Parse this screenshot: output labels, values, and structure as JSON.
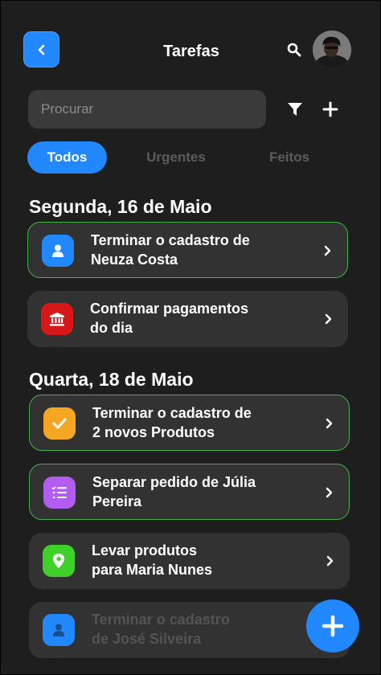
{
  "header": {
    "title": "Tarefas",
    "back_icon": "chevron-left-icon",
    "search_icon": "search-icon",
    "avatar": "user-avatar"
  },
  "search": {
    "placeholder": "Procurar",
    "value": ""
  },
  "toolbar": {
    "filter_icon": "filter-icon",
    "add_icon": "plus-icon"
  },
  "tabs": [
    {
      "label": "Todos",
      "active": true
    },
    {
      "label": "Urgentes",
      "active": false
    },
    {
      "label": "Feitos",
      "active": false
    }
  ],
  "sections": [
    {
      "title": "Segunda, 16 de Maio",
      "tasks": [
        {
          "label": "Terminar o cadastro de\nNeuza Costa",
          "icon": "user-icon",
          "color": "#2188ff",
          "highlighted": true
        },
        {
          "label": "Confirmar pagamentos\ndo dia",
          "icon": "bank-icon",
          "color": "#d81818",
          "highlighted": false
        }
      ]
    },
    {
      "title": "Quarta, 18 de Maio",
      "tasks": [
        {
          "label": "Terminar o cadastro de\n2 novos Produtos",
          "icon": "check-icon",
          "color": "#f5a623",
          "highlighted": true
        },
        {
          "label": "Separar pedido de Júlia\nPereira",
          "icon": "checklist-icon",
          "color": "#b25cf0",
          "highlighted": true
        },
        {
          "label": "Levar produtos\npara Maria Nunes",
          "icon": "location-pin-icon",
          "color": "#3fd02a",
          "highlighted": false
        },
        {
          "label": "Terminar o cadastro\nde José Silveira",
          "icon": "user-icon",
          "color": "#2188ff",
          "highlighted": false,
          "faded": true
        }
      ]
    }
  ],
  "fab": {
    "icon": "plus-icon",
    "color": "#2188ff"
  },
  "colors": {
    "background": "#1e1e1e",
    "card": "#323232",
    "accent": "#2188ff",
    "highlight_border": "#3fb24a"
  }
}
